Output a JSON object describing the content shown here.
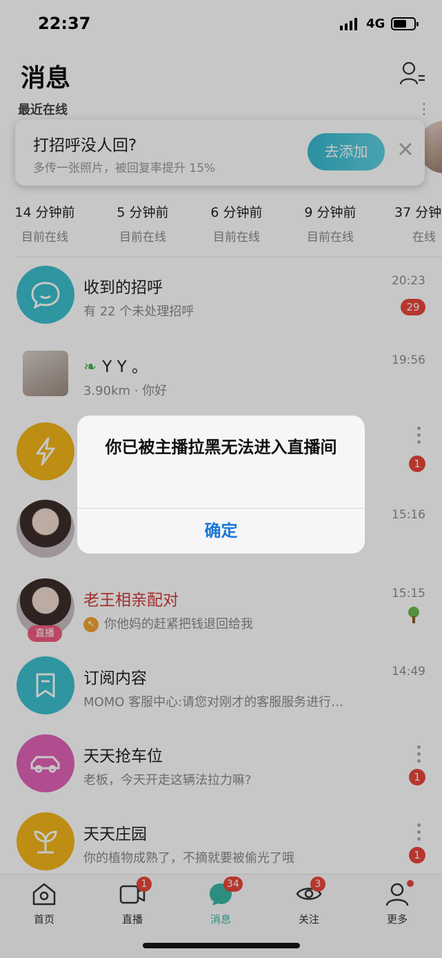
{
  "status": {
    "time": "22:37",
    "network": "4G"
  },
  "header": {
    "title": "消息",
    "online_section_title": "最近在线"
  },
  "promo": {
    "title": "打招呼没人回?",
    "subtitle": "多传一张照片，被回复率提升 15%",
    "button": "去添加"
  },
  "online": [
    {
      "time": "14 分钟前",
      "status": "目前在线"
    },
    {
      "time": "5 分钟前",
      "status": "目前在线"
    },
    {
      "time": "6 分钟前",
      "status": "目前在线"
    },
    {
      "time": "9 分钟前",
      "status": "目前在线"
    },
    {
      "time": "37 分钟",
      "status": "在线"
    }
  ],
  "messages": [
    {
      "name": "收到的招呼",
      "sub": "有 22 个未处理招呼",
      "time": "20:23",
      "badge": "29"
    },
    {
      "name": "Y Y 。",
      "sub": "3.90km · 你好",
      "time": "19:56"
    },
    {
      "badge": "1"
    },
    {
      "time": "15:16"
    },
    {
      "name": "老王相亲配对",
      "sub": "你他妈的赶紧把钱退回给我",
      "time": "15:15",
      "tag": "直播"
    },
    {
      "name": "订阅内容",
      "sub": "MOMO 客服中心:请您对刚才的客服服务进行…",
      "time": "14:49"
    },
    {
      "name": "天天抢车位",
      "sub": "老板，今天开走这辆法拉力嘛?",
      "badge": "1"
    },
    {
      "name": "天天庄园",
      "sub": "你的植物成熟了，不摘就要被偷光了哦",
      "badge": "1"
    }
  ],
  "alert": {
    "message": "你已被主播拉黑无法进入直播间",
    "confirm": "确定"
  },
  "tabs": [
    {
      "label": "首页",
      "icon": "home-icon"
    },
    {
      "label": "直播",
      "icon": "video-icon",
      "badge": "1"
    },
    {
      "label": "消息",
      "icon": "message-icon",
      "badge": "34"
    },
    {
      "label": "关注",
      "icon": "eye-icon",
      "badge": "3"
    },
    {
      "label": "更多",
      "icon": "person-icon"
    }
  ],
  "colors": {
    "accent": "#3ab7a4",
    "badge": "#e8473c",
    "alert_button": "#1a78d6"
  }
}
